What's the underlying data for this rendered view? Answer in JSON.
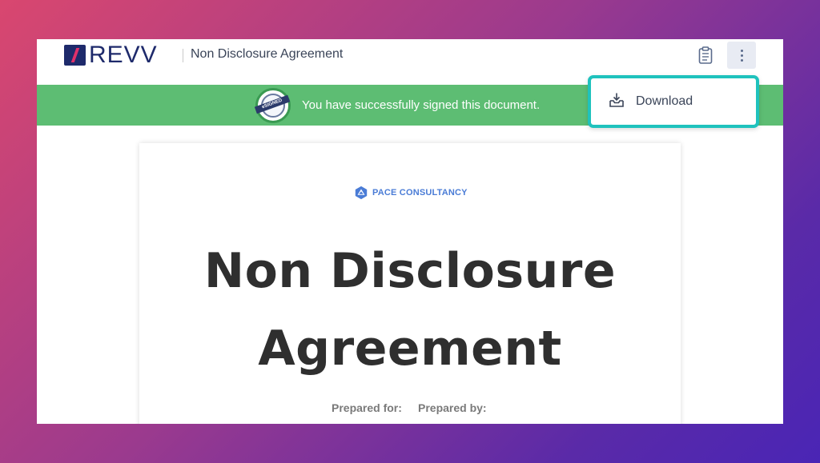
{
  "header": {
    "logo_text": "REVV",
    "document_title": "Non Disclosure Agreement",
    "clipboard_icon": "clipboard-icon",
    "more_icon": "vertical-dots-icon"
  },
  "banner": {
    "seal_text": "eSIGNED",
    "message": "You have successfully signed this document.",
    "color": "#5dbd73"
  },
  "menu": {
    "items": [
      {
        "label": "Download",
        "icon": "download-icon"
      }
    ],
    "highlight_color": "#1fc2bd"
  },
  "document": {
    "brand_name": "PACE CONSULTANCY",
    "title_line1": "Non Disclosure",
    "title_line2": "Agreement",
    "prepared_for_label": "Prepared for:",
    "prepared_by_label": "Prepared by:"
  }
}
